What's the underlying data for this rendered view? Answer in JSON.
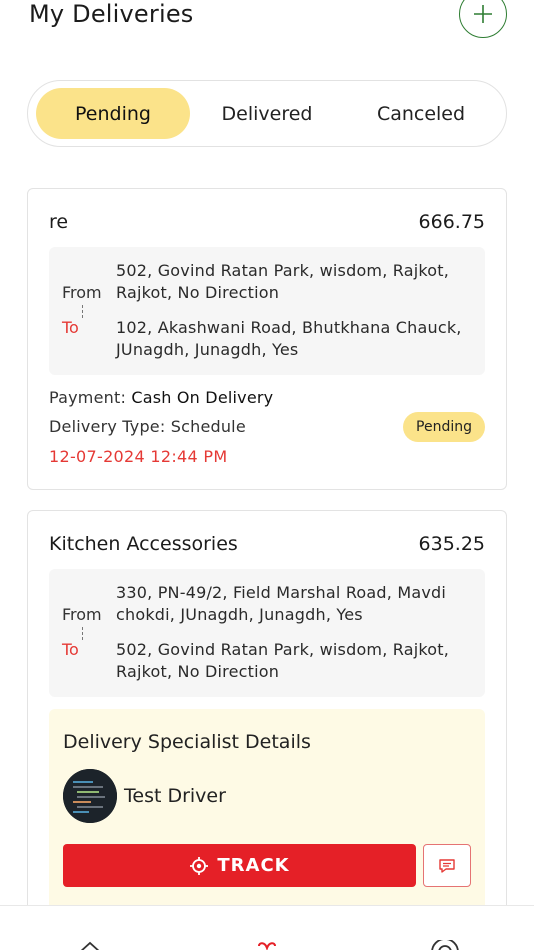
{
  "header": {
    "title": "My Deliveries",
    "add_icon": "plus-icon"
  },
  "tabs": [
    {
      "label": "Pending",
      "active": true
    },
    {
      "label": "Delivered",
      "active": false
    },
    {
      "label": "Canceled",
      "active": false
    }
  ],
  "deliveries": [
    {
      "name": "re",
      "amount": "666.75",
      "from_label": "From",
      "to_label": "To",
      "from_address": "502, Govind Ratan Park, wisdom, Rajkot, Rajkot, No Direction",
      "to_address": "102, Akashwani Road, Bhutkhana Chauck, JUnagdh, Junagdh, Yes",
      "payment_label": "Payment:",
      "payment_value": "Cash On Delivery",
      "delivery_type_label": "Delivery Type:",
      "delivery_type_value": "Schedule",
      "status": "Pending",
      "datetime": "12-07-2024 12:44 PM"
    },
    {
      "name": "Kitchen Accessories",
      "amount": "635.25",
      "from_label": "From",
      "to_label": "To",
      "from_address": "330, PN-49/2, Field Marshal Road, Mavdi chokdi, JUnagdh, Junagdh, Yes",
      "to_address": "502, Govind Ratan Park, wisdom, Rajkot, Rajkot, No Direction",
      "specialist": {
        "title": "Delivery Specialist Details",
        "driver_name": "Test Driver",
        "track_label": "TRACK"
      }
    }
  ],
  "colors": {
    "accent_yellow": "#fbe38a",
    "accent_red": "#e52027",
    "add_green": "#2e7d32"
  }
}
